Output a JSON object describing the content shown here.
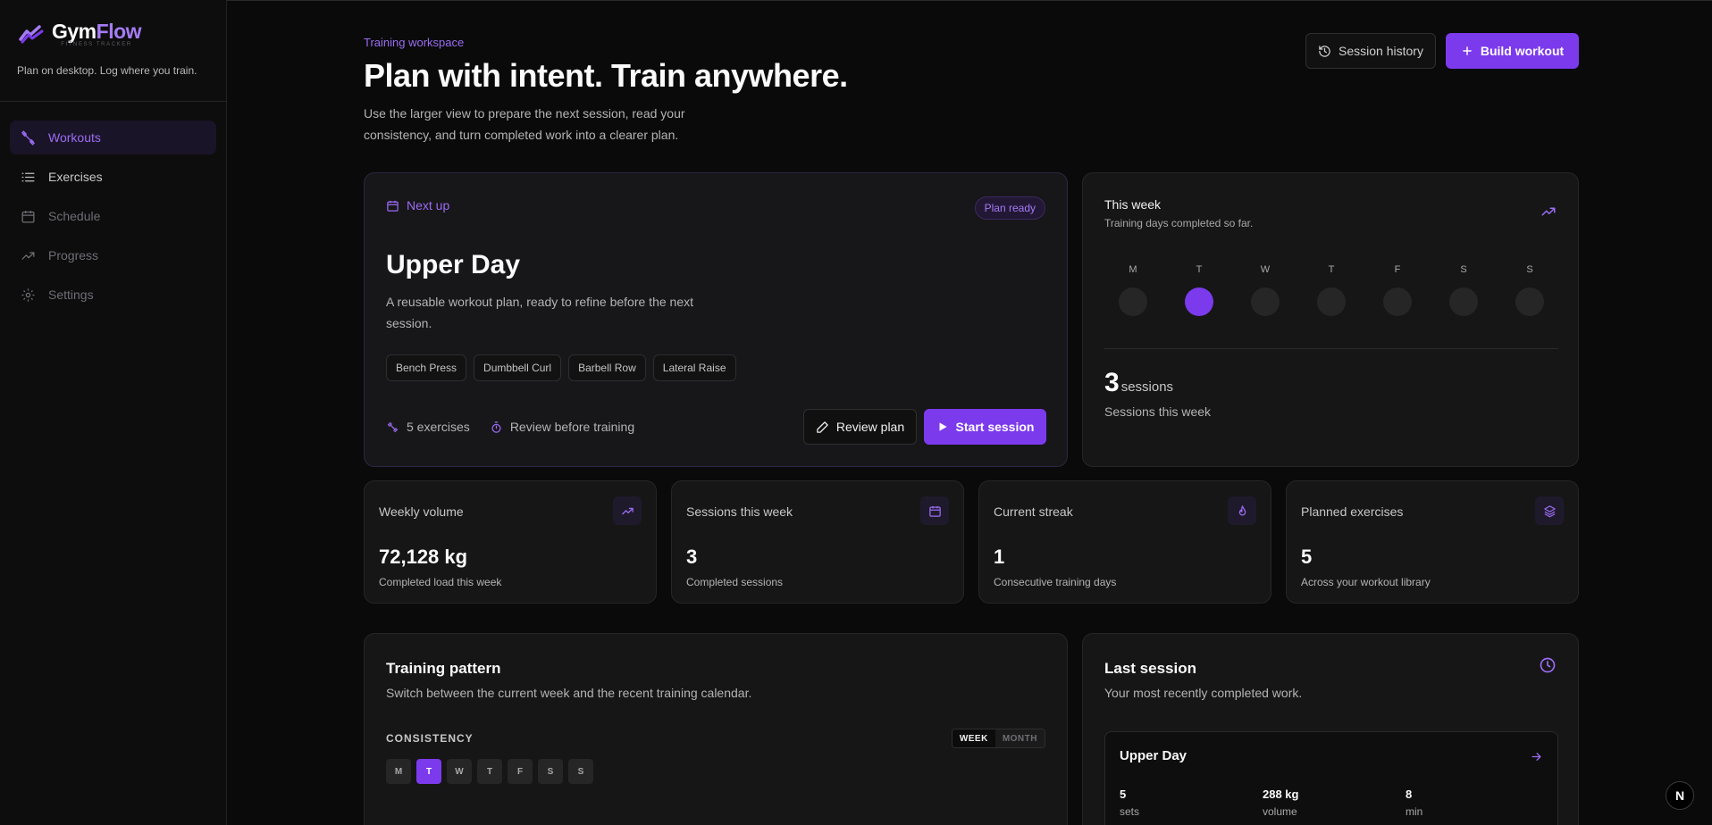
{
  "app": {
    "name_a": "Gym",
    "name_b": "Flow",
    "subtitle": "FITNESS TRACKER",
    "tagline": "Plan on desktop. Log where you train."
  },
  "sidebar": {
    "items": [
      {
        "label": "Workouts",
        "icon": "dumbbell-icon",
        "active": true
      },
      {
        "label": "Exercises",
        "icon": "list-icon"
      },
      {
        "label": "Schedule",
        "icon": "calendar-icon"
      },
      {
        "label": "Progress",
        "icon": "trending-up-icon"
      },
      {
        "label": "Settings",
        "icon": "gear-icon"
      }
    ]
  },
  "header": {
    "eyebrow": "Training workspace",
    "title": "Plan with intent. Train anywhere.",
    "lead": "Use the larger view to prepare the next session, read your consistency, and turn completed work into a clearer plan.",
    "history_label": "Session history",
    "build_label": "Build workout"
  },
  "next_up": {
    "label": "Next up",
    "badge": "Plan ready",
    "title": "Upper Day",
    "description": "A reusable workout plan, ready to refine before the next session.",
    "exercises": [
      "Bench Press",
      "Dumbbell Curl",
      "Barbell Row",
      "Lateral Raise"
    ],
    "meta_exercises": "5 exercises",
    "meta_review": "Review before training",
    "review_label": "Review plan",
    "start_label": "Start session"
  },
  "week": {
    "title": "This week",
    "subtitle": "Training days completed so far.",
    "days": [
      "M",
      "T",
      "W",
      "T",
      "F",
      "S",
      "S"
    ],
    "completed": [
      false,
      true,
      false,
      false,
      false,
      false,
      false
    ],
    "count": "3",
    "count_unit": "sessions",
    "footer": "Sessions this week"
  },
  "stats": [
    {
      "label": "Weekly volume",
      "value": "72,128 kg",
      "sub": "Completed load this week",
      "icon": "trending-up-icon"
    },
    {
      "label": "Sessions this week",
      "value": "3",
      "sub": "Completed sessions",
      "icon": "calendar-icon"
    },
    {
      "label": "Current streak",
      "value": "1",
      "sub": "Consecutive training days",
      "icon": "flame-icon"
    },
    {
      "label": "Planned exercises",
      "value": "5",
      "sub": "Across your workout library",
      "icon": "layers-icon"
    }
  ],
  "pattern": {
    "title": "Training pattern",
    "subtitle": "Switch between the current week and the recent training calendar.",
    "consistency_label": "CONSISTENCY",
    "tab_week": "WEEK",
    "tab_month": "MONTH",
    "days": [
      "M",
      "T",
      "W",
      "T",
      "F",
      "S",
      "S"
    ]
  },
  "last_session": {
    "title": "Last session",
    "subtitle": "Your most recently completed work.",
    "name": "Upper Day",
    "sets_value": "5",
    "sets_label": "sets",
    "volume_value": "288 kg",
    "volume_label": "volume",
    "duration_value": "8",
    "duration_label": "min"
  },
  "misc": {
    "badge_letter": "N"
  },
  "colors": {
    "accent": "#7c3aed",
    "accent_text": "#9b6cf3",
    "background": "#0a0a0a",
    "card": "#161616"
  }
}
